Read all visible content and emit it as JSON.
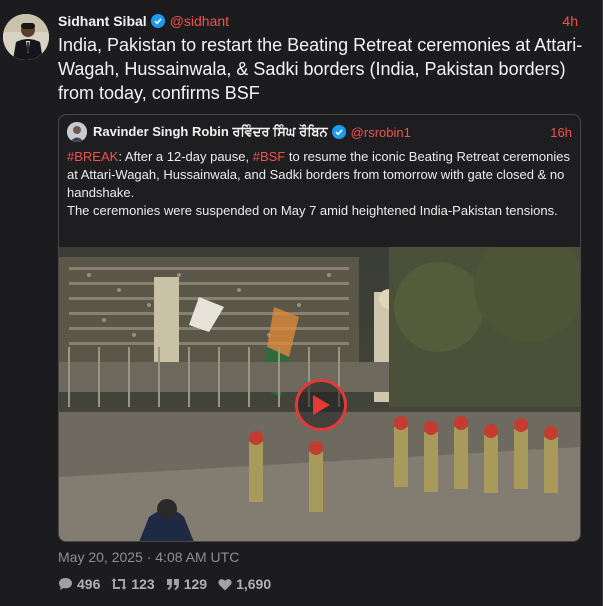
{
  "tweet": {
    "author_name": "Sidhant Sibal",
    "handle": "@sidhant",
    "time": "4h",
    "text": "India, Pakistan to restart the Beating Retreat ceremonies at Attari-Wagah, Hussainwala, & Sadki borders (India, Pakistan borders) from today, confirms BSF",
    "timestamp": "May 20, 2025 · 4:08 AM UTC"
  },
  "quote": {
    "author_name": "Ravinder Singh Robin ਰਵਿੰਦਰ ਸਿੰਘ ਰੌਬਿਨ",
    "handle": "@rsrobin1",
    "time": "16h",
    "tag1": "#BREAK",
    "text1": ": After a 12-day pause, ",
    "tag2": "#BSF",
    "text2": " to resume the iconic Beating Retreat ceremonies at Attari-Wagah, Hussainwala, and Sadki borders from tomorrow with gate closed & no handshake.",
    "text3": "The ceremonies were suspended on May 7 amid heightened India-Pakistan tensions."
  },
  "stats": {
    "replies": "496",
    "retweets": "123",
    "quotes": "129",
    "likes": "1,690"
  },
  "colors": {
    "background": "#1c1c1e",
    "accent": "#ef5350",
    "verified": "#1d9bf0",
    "muted": "#8e8e93"
  },
  "icons": [
    "verified-badge-icon",
    "play-icon",
    "reply-icon",
    "retweet-icon",
    "quote-icon",
    "like-icon"
  ]
}
